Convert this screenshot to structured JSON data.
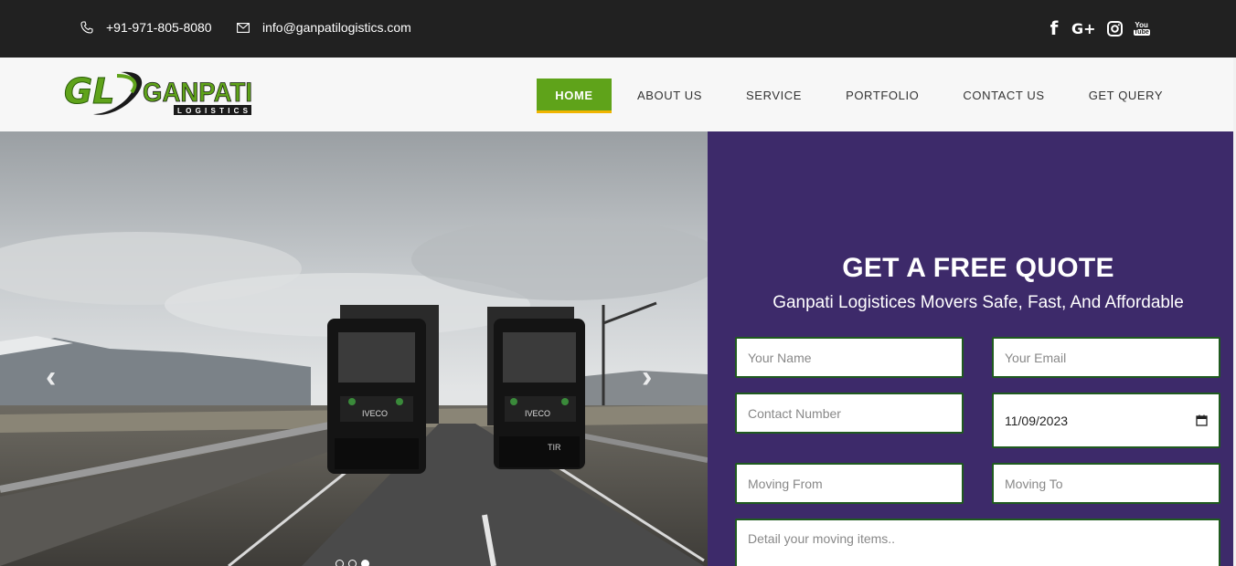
{
  "topbar": {
    "phone": "+91-971-805-8080",
    "email": "info@ganpatilogistics.com",
    "social": [
      "facebook-icon",
      "google-plus-icon",
      "instagram-icon",
      "youtube-icon"
    ],
    "google_plus_label": "G+",
    "youtube_you": "You",
    "youtube_tube": "Tube"
  },
  "logo": {
    "initials": "GL",
    "name": "GANPATI",
    "tagline": "LOGISTICS"
  },
  "nav": {
    "home": "HOME",
    "about": "ABOUT US",
    "service": "SERVICE",
    "portfolio": "PORTFOLIO",
    "contact": "CONTACT US",
    "query": "GET QUERY"
  },
  "hero": {
    "truck_left_text": "IVECO",
    "truck_right_text": "IVECO",
    "plate_right": "TIR",
    "slides": 3,
    "active_slide": 3
  },
  "quote": {
    "title": "GET A FREE QUOTE",
    "subtitle": "Ganpati Logistices Movers Safe, Fast, And Affordable",
    "name_placeholder": "Your Name",
    "email_placeholder": "Your Email",
    "contact_placeholder": "Contact Number",
    "date_value": "11/09/2023",
    "from_placeholder": "Moving From",
    "to_placeholder": "Moving To",
    "detail_placeholder": "Detail your moving items.."
  },
  "colors": {
    "topbar": "#212121",
    "accent_green": "#5fa31a",
    "nav_underline": "#f0b400",
    "quote_panel": "#3d2a6a",
    "field_border": "#1f5a1f"
  }
}
